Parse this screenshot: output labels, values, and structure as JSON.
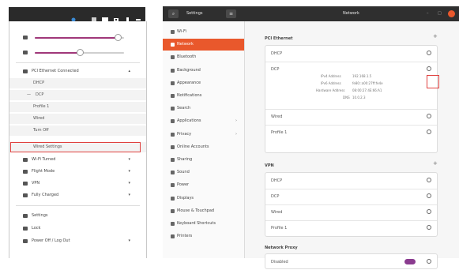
{
  "topbar": {
    "icons": [
      "accessibility-icon",
      "network-wired-icon",
      "volume-icon",
      "battery-icon",
      "power-icon"
    ]
  },
  "system_menu": {
    "wired_connected": "PCI Ethernet Connected",
    "wired_submenu": [
      "DHCP",
      "DCP",
      "Profile 1",
      "Wired",
      "Turn Off",
      "Wired Settings"
    ],
    "wifi": "Wi-Fi Turned",
    "flight": "Flight Mode",
    "vpn": "VPN",
    "battery": "Fully Charged",
    "settings": "Settings",
    "lock": "Lock",
    "power": "Power Off / Log Out",
    "volume_level": 0.93,
    "brightness_level": 0.5,
    "accent_color": "#a0387a",
    "highlight_color": "#e0413f"
  },
  "window": {
    "title_left": "Settings",
    "title_center": "Network",
    "accent_color": "#e9582c"
  },
  "sidebar": {
    "items": [
      {
        "label": "Wi-Fi",
        "icon": "wifi-icon"
      },
      {
        "label": "Network",
        "icon": "network-icon",
        "active": true
      },
      {
        "label": "Bluetooth",
        "icon": "bluetooth-icon"
      },
      {
        "label": "Background",
        "icon": "background-icon"
      },
      {
        "label": "Appearance",
        "icon": "appearance-icon"
      },
      {
        "label": "Notifications",
        "icon": "bell-icon"
      },
      {
        "label": "Search",
        "icon": "search-icon"
      },
      {
        "label": "Applications",
        "icon": "apps-icon",
        "chevron": true
      },
      {
        "label": "Privacy",
        "icon": "lock-icon",
        "chevron": true
      },
      {
        "label": "Online Accounts",
        "icon": "cloud-icon"
      },
      {
        "label": "Sharing",
        "icon": "share-icon"
      },
      {
        "label": "Sound",
        "icon": "sound-icon"
      },
      {
        "label": "Power",
        "icon": "power-icon"
      },
      {
        "label": "Displays",
        "icon": "display-icon"
      },
      {
        "label": "Mouse & Touchpad",
        "icon": "mouse-icon"
      },
      {
        "label": "Keyboard Shortcuts",
        "icon": "keyboard-icon"
      },
      {
        "label": "Printers",
        "icon": "printer-icon"
      }
    ]
  },
  "content": {
    "sections": {
      "ethernet_title": "PCI Ethernet",
      "vpn_title": "VPN",
      "proxy_title": "Network Proxy"
    },
    "ethernet_rows": [
      "DHCP",
      "DCP",
      "Wired",
      "Profile 1"
    ],
    "ethernet_details": {
      "labels": [
        "IPv4 Address",
        "IPv6 Address",
        "Hardware Address",
        "DNS"
      ],
      "values": [
        "192.168.1.5",
        "fe80::a00:27ff:fe4e",
        "08:00:27:4E:66:A1",
        "10.0.2.3"
      ]
    },
    "vpn_rows": [
      "DHCP",
      "DCP",
      "Wired",
      "Profile 1"
    ],
    "proxy_row": "Disabled",
    "proxy_toggle_on": true
  }
}
